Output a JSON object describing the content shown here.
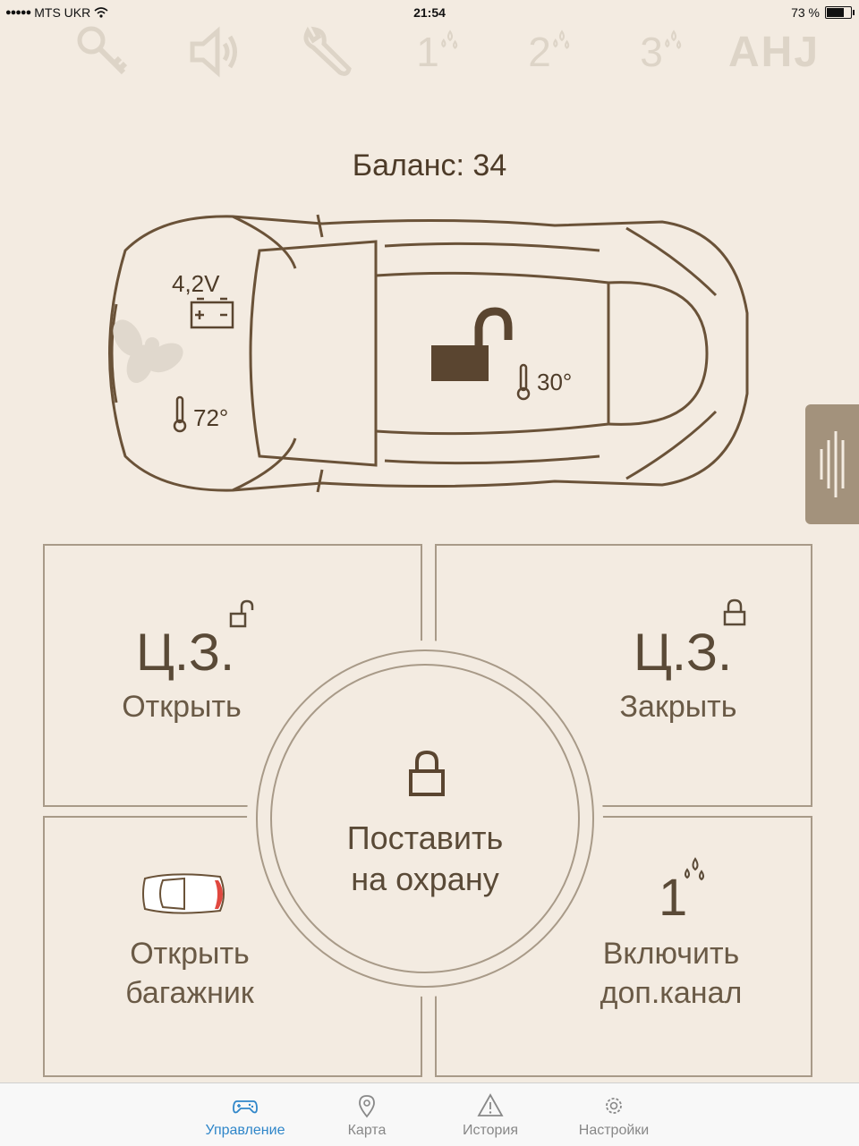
{
  "status": {
    "carrier": "MTS UKR",
    "time": "21:54",
    "battery": "73 %",
    "battery_level": 0.73
  },
  "quick_bar": {
    "ch1": "1",
    "ch2": "2",
    "ch3": "3",
    "ahj": "AHJ"
  },
  "balance": "Баланс: 34",
  "car": {
    "voltage": "4,2V",
    "engine_temp": "72°",
    "cabin_temp": "30°"
  },
  "panels": {
    "open_short": "Ц.З.",
    "open_label": "Открыть",
    "close_short": "Ц.З.",
    "close_label": "Закрыть",
    "trunk_line1": "Открыть",
    "trunk_line2": "багажник",
    "channel_num": "1",
    "channel_line1": "Включить",
    "channel_line2": "доп.канал"
  },
  "guard": {
    "line1": "Поставить",
    "line2": "на охрану"
  },
  "tabs": [
    {
      "label": "Управление",
      "icon": "gamepad-icon"
    },
    {
      "label": "Карта",
      "icon": "map-pin-icon"
    },
    {
      "label": "История",
      "icon": "warning-icon"
    },
    {
      "label": "Настройки",
      "icon": "gear-icon"
    }
  ],
  "colors": {
    "background": "#f3ebe1",
    "accent_tab": "#2f86c9",
    "lock": "#5a4530",
    "trunk_red": "#e0483f"
  }
}
